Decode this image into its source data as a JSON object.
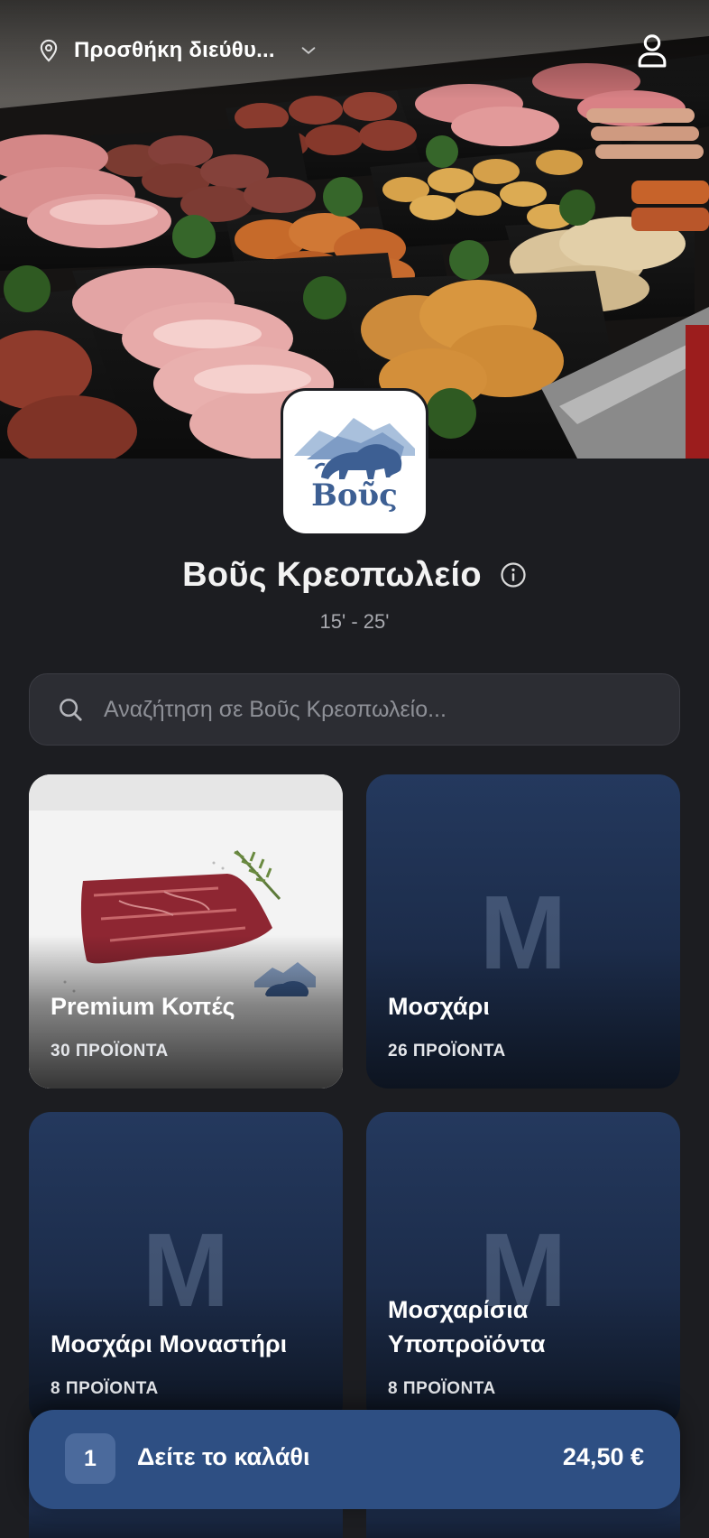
{
  "header": {
    "address_label": "Προσθήκη διεύθυ...",
    "icons": {
      "location": "map-pin-icon",
      "dropdown": "chevron-down-icon",
      "profile": "user-icon"
    }
  },
  "store": {
    "logo_text": "Βοῦς",
    "name": "Βοῦς Κρεοπωλείο",
    "eta": "15' - 25'",
    "info_icon": "info-circle-icon"
  },
  "search": {
    "placeholder": "Αναζήτηση σε Βοῦς Κρεοπωλείο...",
    "value": "",
    "icon": "search-icon"
  },
  "categories": [
    {
      "title": "Premium Κοπές",
      "count": "30 ΠΡΟΪΟΝΤΑ",
      "placeholder": "",
      "image": "beef-steak-photo"
    },
    {
      "title": "Μοσχάρι",
      "count": "26 ΠΡΟΪΟΝΤΑ",
      "placeholder": "M"
    },
    {
      "title": "Μοσχάρι Μοναστήρι",
      "count": "8 ΠΡΟΪΟΝΤΑ",
      "placeholder": "M"
    },
    {
      "title": "Μοσχαρίσια Υποπροϊόντα",
      "count": "8 ΠΡΟΪΟΝΤΑ",
      "placeholder": "M"
    }
  ],
  "cart": {
    "quantity": "1",
    "label": "Δείτε το καλάθι",
    "total": "24,50 €"
  },
  "colors": {
    "background": "#1c1d21",
    "card_blue": "#24395e",
    "cart_blue": "#2e4f83",
    "brand_blue": "#3d5f93"
  }
}
